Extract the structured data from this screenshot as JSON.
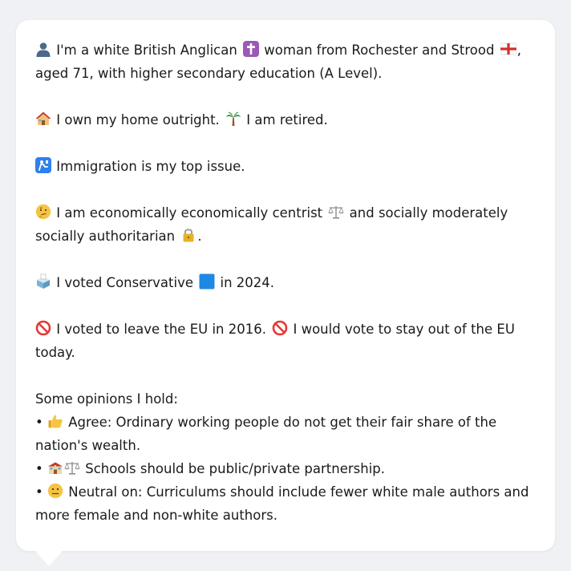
{
  "persona": {
    "identity": {
      "text1": "I'm a white British Anglican",
      "text2": "woman from Rochester and Strood",
      "text3": ",",
      "text4": "aged 71, with higher secondary education (A Level).",
      "icons": [
        "person-silhouette-icon",
        "latin-cross-icon",
        "england-flag-icon"
      ]
    },
    "home": {
      "text1": "I own my home outright.",
      "text2": "I am retired.",
      "icons": [
        "house-icon",
        "palm-tree-icon"
      ]
    },
    "issue": {
      "text": "Immigration is my top issue.",
      "icons": [
        "passport-control-icon"
      ]
    },
    "politics": {
      "text1": "I am economically economically centrist",
      "text2": "and socially moderately",
      "text3": "socially authoritarian",
      "text4": ".",
      "icons": [
        "thinking-face-icon",
        "balance-scale-icon",
        "padlock-icon"
      ]
    },
    "vote": {
      "text1": "I voted Conservative",
      "text2": "in 2024.",
      "icons": [
        "ballot-box-icon",
        "blue-square-icon"
      ],
      "colors": {
        "conservative_blue": "#1e88e5"
      }
    },
    "eu": {
      "text1": "I voted to leave the EU in 2016.",
      "text2": "I would vote to stay out of the EU",
      "text3": "today.",
      "icons": [
        "prohibited-icon",
        "prohibited-icon"
      ]
    },
    "opinions": {
      "heading": "Some opinions I hold:",
      "bullet": "•",
      "item1_line1": "Agree: Ordinary working people do not get their fair share of the",
      "item1_line2": "nation's wealth.",
      "item2": "Schools should be public/private partnership.",
      "item3_line1": "Neutral on: Curriculums should include fewer white male authors and",
      "item3_line2": "more female and non-white authors.",
      "icons": [
        "thumbs-up-icon",
        "school-icon",
        "balance-scale-icon",
        "neutral-face-icon"
      ]
    }
  }
}
